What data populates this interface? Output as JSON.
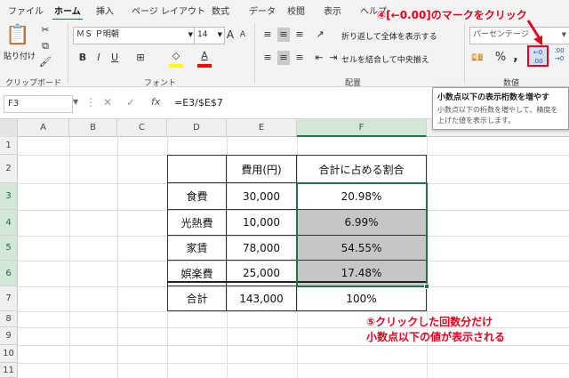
{
  "tabs": [
    "ファイル",
    "ホーム",
    "挿入",
    "ページ レイアウト",
    "数式",
    "データ",
    "校閲",
    "表示",
    "ヘルプ"
  ],
  "active_tab": "ホーム",
  "clipboard": {
    "paste_label": "貼り付け",
    "group_label": "クリップボード"
  },
  "font": {
    "name": "ＭＳ Ｐ明朝",
    "size": "14",
    "grow": "A",
    "shrink": "A",
    "bold": "B",
    "italic": "I",
    "underline": "U",
    "group_label": "フォント",
    "fill_color": "#ffff00",
    "font_color": "#ff0000"
  },
  "alignment": {
    "wrap_text": "折り返して全体を表示する",
    "merge_center": "セルを結合して中央揃え",
    "group_label": "配置"
  },
  "number": {
    "format": "パーセンテージ",
    "percent": "%",
    "comma": ",",
    "increase_decimal": "←0 .00",
    "decrease_decimal": ".00 →0",
    "group_label": "数値"
  },
  "formula_bar": {
    "name_box": "F3",
    "cancel": "✕",
    "enter": "✓",
    "fx": "fx",
    "formula": "=E3/$E$7"
  },
  "tooltip": {
    "title": "小数点以下の表示桁数を増やす",
    "body": "小数点以下の桁数を増やして、精度を上げた値を表示します。"
  },
  "annotations": {
    "step4": "④[←0.00]のマークをクリック",
    "step5_line1": "⑤クリックした回数分だけ",
    "step5_line2": "小数点以下の値が表示される"
  },
  "columns": [
    "A",
    "B",
    "C",
    "D",
    "E",
    "F"
  ],
  "rows": [
    "1",
    "2",
    "3",
    "4",
    "5",
    "6",
    "7",
    "8",
    "9",
    "10",
    "11"
  ],
  "table": {
    "headers": [
      "費用(円)",
      "合計に占める割合"
    ],
    "items": [
      {
        "label": "食費",
        "cost": "30,000",
        "ratio": "20.98%"
      },
      {
        "label": "光熱費",
        "cost": "10,000",
        "ratio": "6.99%"
      },
      {
        "label": "家賃",
        "cost": "78,000",
        "ratio": "54.55%"
      },
      {
        "label": "娯楽費",
        "cost": "25,000",
        "ratio": "17.48%"
      }
    ],
    "total": {
      "label": "合計",
      "cost": "143,000",
      "ratio": "100%"
    }
  },
  "colors": {
    "accent": "#217346",
    "annotation": "#e8001c",
    "selection": "#c6c6c6"
  }
}
